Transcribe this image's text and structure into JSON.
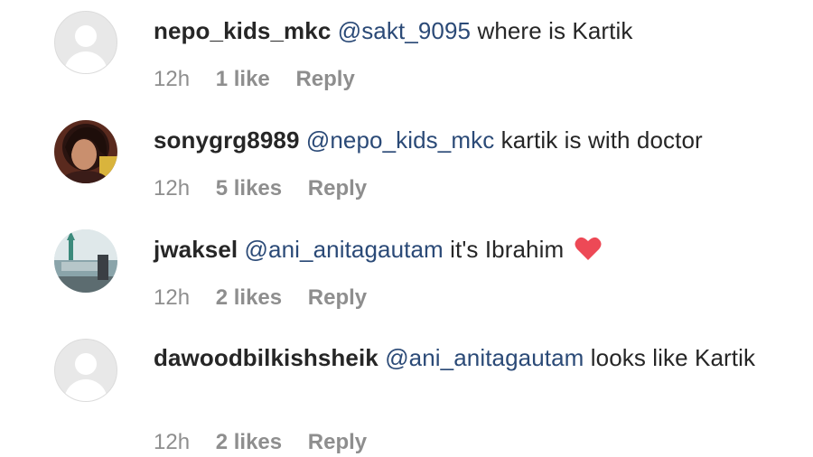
{
  "comments": [
    {
      "avatar": "default-avatar-icon",
      "username": "nepo_kids_mkc",
      "mention": "@sakt_9095",
      "text": "where is Kartik",
      "time": "12h",
      "likes": "1 like",
      "reply": "Reply"
    },
    {
      "avatar": "profile-photo",
      "username": "sonygrg8989",
      "mention": "@nepo_kids_mkc",
      "text": "kartik is with doctor",
      "time": "12h",
      "likes": "5 likes",
      "reply": "Reply"
    },
    {
      "avatar": "profile-photo",
      "username": "jwaksel",
      "mention": "@ani_anitagautam",
      "text": "it's Ibrahim",
      "emoji": "heart-icon",
      "time": "12h",
      "likes": "2 likes",
      "reply": "Reply"
    },
    {
      "avatar": "default-avatar-icon",
      "username": "dawoodbilkishsheik",
      "mention": "@ani_anitagautam",
      "text": "looks like Kartik",
      "time": "12h",
      "likes": "2 likes",
      "reply": "Reply"
    }
  ],
  "colors": {
    "text": "#262626",
    "mention": "#2b4a77",
    "meta": "#8e8e8e",
    "heart": "#ed4956"
  }
}
